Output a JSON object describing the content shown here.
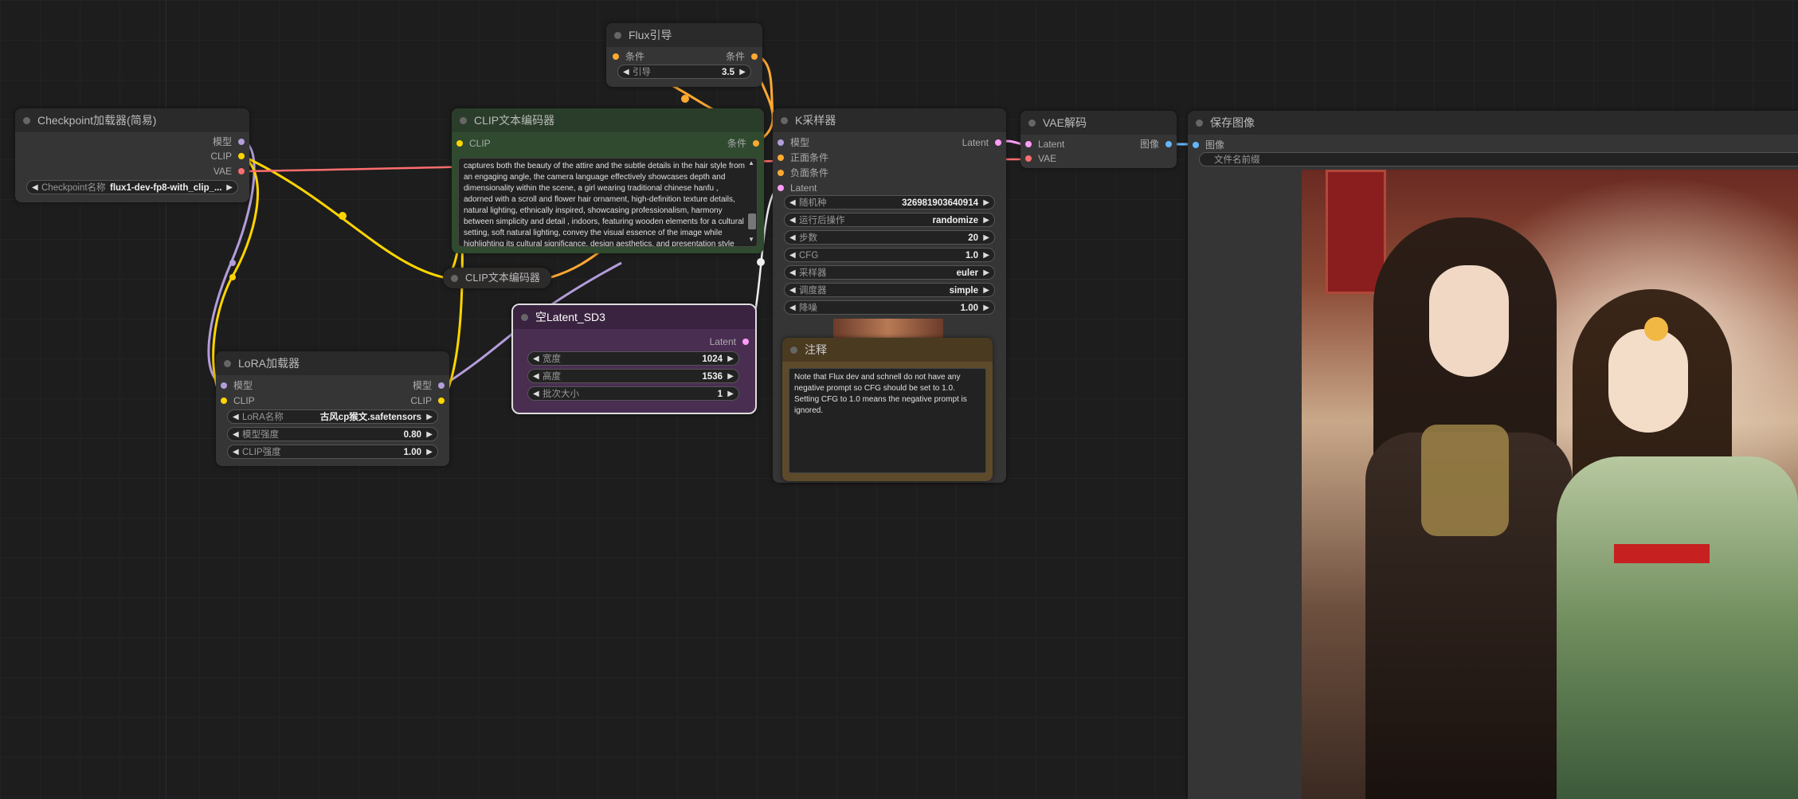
{
  "colors": {
    "canvas": "#1d1d1d",
    "node": "#353535",
    "clip_node": "#2f4a2f",
    "latent_node": "#4a2e52",
    "note_node": "#5c4a2a",
    "wire_model": "#b39ddb",
    "wire_clip": "#ffd500",
    "wire_vae": "#ff6e6e",
    "wire_cond": "#ffa931",
    "wire_latent": "#ff9cf9",
    "wire_image": "#64b5f6"
  },
  "flux_guidance": {
    "title": "Flux引导",
    "in_cond": "条件",
    "out_cond": "条件",
    "guidance_label": "引导",
    "guidance_value": "3.5"
  },
  "checkpoint": {
    "title": "Checkpoint加载器(简易)",
    "out_model": "模型",
    "out_clip": "CLIP",
    "out_vae": "VAE",
    "ckpt_label": "Checkpoint名称",
    "ckpt_value": "flux1-dev-fp8-with_clip_..."
  },
  "clip_encoder": {
    "title": "CLIP文本编码器",
    "in_clip": "CLIP",
    "out_cond": "条件",
    "prompt": "captures both the beauty of the attire and the subtle details in the hair style from an engaging angle, the camera language effectively showcases depth and dimensionality within the scene,  a girl wearing traditional chinese hanfu , adorned with a scroll and flower hair ornament, high-definition texture details, natural lighting, ethnically inspired, showcasing professionalism, harmony between simplicity and detail , indoors, featuring wooden elements for a cultural setting, soft natural lighting, convey the visual essence of the image while highlighting its cultural significance, design aesthetics, and presentation style"
  },
  "clip_encoder_collapsed": {
    "title": "CLIP文本编码器"
  },
  "empty_latent": {
    "title": "空Latent_SD3",
    "out_latent": "Latent",
    "width_label": "宽度",
    "width_value": "1024",
    "height_label": "高度",
    "height_value": "1536",
    "batch_label": "批次大小",
    "batch_value": "1"
  },
  "lora": {
    "title": "LoRA加载器",
    "in_model": "模型",
    "in_clip": "CLIP",
    "out_model": "模型",
    "out_clip": "CLIP",
    "name_label": "LoRA名称",
    "name_value": "古风cp猴文.safetensors",
    "model_strength_label": "模型强度",
    "model_strength_value": "0.80",
    "clip_strength_label": "CLIP强度",
    "clip_strength_value": "1.00"
  },
  "ksampler": {
    "title": "K采样器",
    "in_model": "模型",
    "in_pos": "正面条件",
    "in_neg": "负面条件",
    "in_latent": "Latent",
    "out_latent": "Latent",
    "seed_label": "随机种",
    "seed_value": "326981903640914",
    "after_label": "运行后操作",
    "after_value": "randomize",
    "steps_label": "步数",
    "steps_value": "20",
    "cfg_label": "CFG",
    "cfg_value": "1.0",
    "sampler_label": "采样器",
    "sampler_value": "euler",
    "scheduler_label": "调度器",
    "scheduler_value": "simple",
    "denoise_label": "降噪",
    "denoise_value": "1.00"
  },
  "note": {
    "title": "注释",
    "text": "Note that Flux dev and schnell do not have any negative prompt so CFG should be set to 1.0. Setting CFG to 1.0 means the negative prompt is ignored."
  },
  "vae_decode": {
    "title": "VAE解码",
    "in_latent": "Latent",
    "in_vae": "VAE",
    "out_image": "图像"
  },
  "save_image": {
    "title": "保存图像",
    "in_image": "图像",
    "filename_prefix_label": "文件名前缀"
  }
}
